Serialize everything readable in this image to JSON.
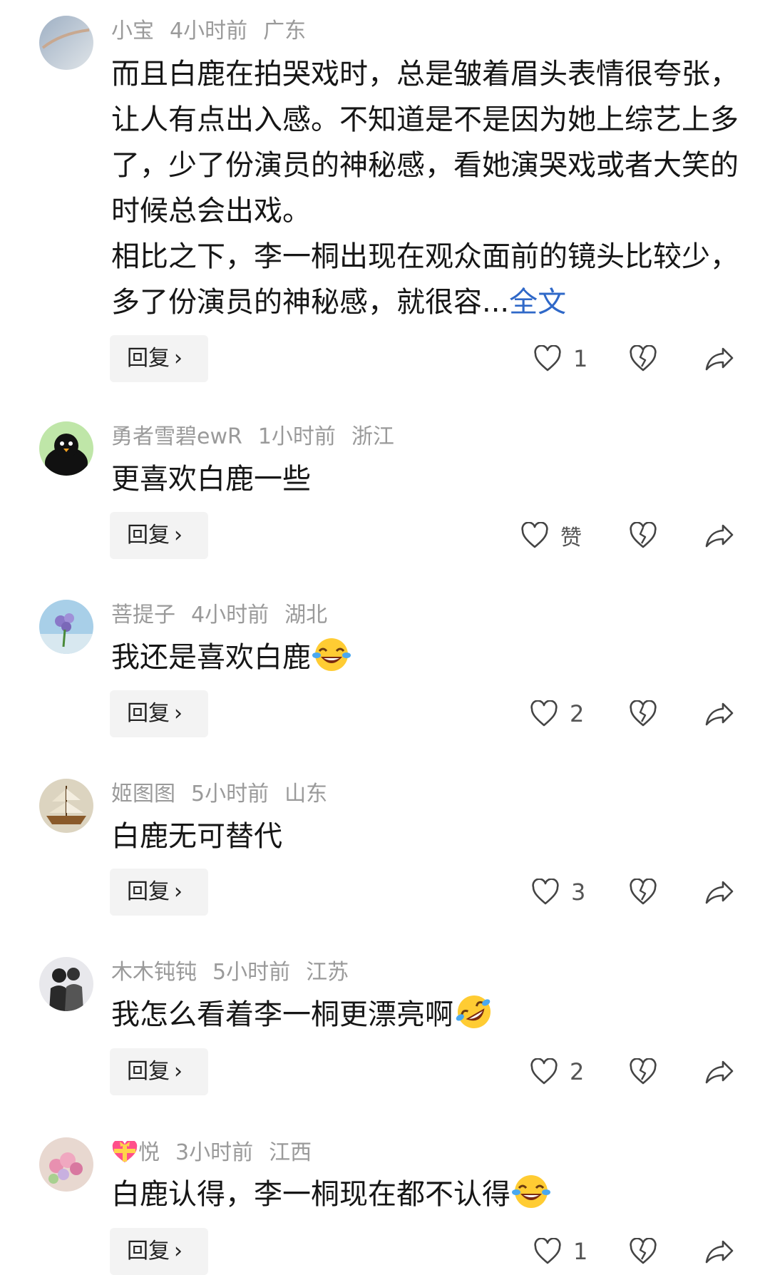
{
  "reply_label": "回复",
  "comments": [
    {
      "user": "小宝",
      "time": "4小时前",
      "location": "广东",
      "paragraphs": [
        "而且白鹿在拍哭戏时，总是皱着眉头表情很夸张，让人有点出入感。不知道是不是因为她上综艺上多了，少了份演员的神秘感，看她演哭戏或者大笑的时候总会出戏。",
        " 相比之下，李一桐出现在观众面前的镜头比较少，多了份演员的神秘感，就很容..."
      ],
      "more_label": "全文",
      "likes": "1",
      "avatar_icon": "sky-photo-avatar",
      "text_emoji": ""
    },
    {
      "user": "勇者雪碧ewR",
      "time": "1小时前",
      "location": "浙江",
      "paragraphs": [
        "更喜欢白鹿一些"
      ],
      "more_label": "",
      "likes": "赞",
      "avatar_icon": "bird-avatar",
      "text_emoji": ""
    },
    {
      "user": "菩提子",
      "time": "4小时前",
      "location": "湖北",
      "paragraphs": [
        "我还是喜欢白鹿"
      ],
      "more_label": "",
      "likes": "2",
      "avatar_icon": "flower-bouquet-avatar",
      "text_emoji": "laughing-tears-emoji"
    },
    {
      "user": "姬图图",
      "time": "5小时前",
      "location": "山东",
      "paragraphs": [
        "白鹿无可替代"
      ],
      "more_label": "",
      "likes": "3",
      "avatar_icon": "sailing-ship-avatar",
      "text_emoji": ""
    },
    {
      "user": "木木钝钝",
      "time": "5小时前",
      "location": "江苏",
      "paragraphs": [
        "我怎么看着李一桐更漂亮啊"
      ],
      "more_label": "",
      "likes": "2",
      "avatar_icon": "couple-avatar",
      "text_emoji": "rolling-laughing-emoji"
    },
    {
      "user": "悦",
      "time": "3小时前",
      "location": "江西",
      "paragraphs": [
        "白鹿认得，李一桐现在都不认得"
      ],
      "more_label": "",
      "likes": "1",
      "avatar_icon": "flowers-avatar",
      "text_emoji": "laughing-tears-emoji",
      "name_badge": "heart-gift-icon"
    }
  ],
  "colors": {
    "link": "#2f68c8",
    "meta": "#9a9a9a",
    "reply_bg": "#f3f3f3"
  }
}
